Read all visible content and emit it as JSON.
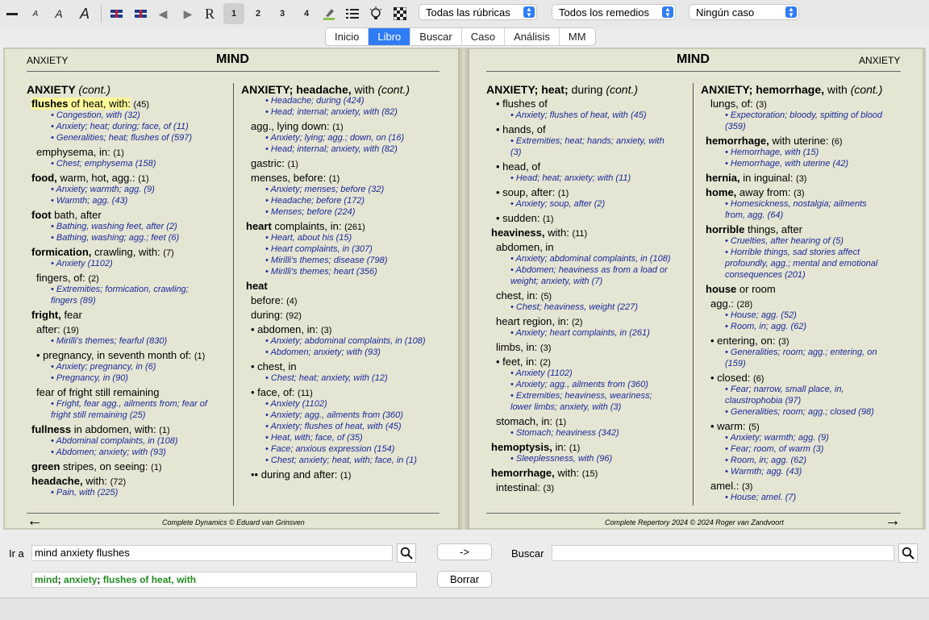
{
  "toolbar": {
    "font_small": "A",
    "font_med": "A",
    "font_large": "A",
    "restore": "R",
    "levels": [
      "1",
      "2",
      "3",
      "4"
    ],
    "select_rubrics": "Todas las rúbricas",
    "select_remedies": "Todos los remedios",
    "select_case": "Ningún caso"
  },
  "tabs": [
    "Inicio",
    "Libro",
    "Buscar",
    "Caso",
    "Análisis",
    "MM"
  ],
  "book": {
    "left": {
      "header_left": "ANXIETY",
      "title": "MIND",
      "footer": "Complete Dynamics © Eduard van Grinsven",
      "col1": [
        {
          "t": "h",
          "text": "ANXIETY",
          "it": "(cont.)"
        },
        {
          "t": "r",
          "b": "flushes",
          "text": " of heat, with:",
          "c": "(45)",
          "hl": true
        },
        {
          "t": "x",
          "text": "• Congestion, with (32)"
        },
        {
          "t": "x",
          "text": "• Anxiety; heat; during; face, of (11)"
        },
        {
          "t": "x",
          "text": "• Generalities; heat; flushes of (597)"
        },
        {
          "t": "r",
          "text": "emphysema, in:",
          "c": "(1)"
        },
        {
          "t": "x",
          "text": "• Chest; emphysema (158)"
        },
        {
          "t": "r",
          "b": "food,",
          "text": " warm, hot, agg.:",
          "c": "(1)"
        },
        {
          "t": "x",
          "text": "• Anxiety; warmth; agg. (9)"
        },
        {
          "t": "x",
          "text": "• Warmth; agg. (43)"
        },
        {
          "t": "r",
          "b": "foot",
          "text": " bath, after"
        },
        {
          "t": "x",
          "text": "• Bathing, washing feet, after (2)"
        },
        {
          "t": "x",
          "text": "• Bathing, washing; agg.; feet (6)"
        },
        {
          "t": "r",
          "b": "formication,",
          "text": " crawling, with:",
          "c": "(7)"
        },
        {
          "t": "x",
          "text": "• Anxiety (1102)"
        },
        {
          "t": "r",
          "text": "fingers, of:",
          "c": "(2)"
        },
        {
          "t": "x",
          "text": "• Extremities; formication, crawling;"
        },
        {
          "t": "x",
          "text": "fingers (89)"
        },
        {
          "t": "r",
          "b": "fright,",
          "text": " fear"
        },
        {
          "t": "r",
          "text": "after:",
          "c": "(19)"
        },
        {
          "t": "x",
          "text": "• Mirilli's themes; fearful (830)"
        },
        {
          "t": "r",
          "text": "• pregnancy, in seventh month of:",
          "c": "(1)"
        },
        {
          "t": "x",
          "text": "• Anxiety; pregnancy, in (6)"
        },
        {
          "t": "x",
          "text": "• Pregnancy, in (90)"
        },
        {
          "t": "r",
          "text": "fear of fright still remaining"
        },
        {
          "t": "x",
          "text": "• Fright, fear agg., ailments from; fear of"
        },
        {
          "t": "x",
          "text": "fright still remaining (25)"
        },
        {
          "t": "r",
          "b": "fullness",
          "text": " in abdomen, with:",
          "c": "(1)"
        },
        {
          "t": "x",
          "text": "• Abdominal complaints, in (108)"
        },
        {
          "t": "x",
          "text": "• Abdomen; anxiety; with (93)"
        },
        {
          "t": "r",
          "b": "green",
          "text": " stripes, on seeing:",
          "c": "(1)"
        },
        {
          "t": "r",
          "b": "headache,",
          "text": " with:",
          "c": "(72)"
        },
        {
          "t": "x",
          "text": "• Pain, with (225)"
        }
      ],
      "col2": [
        {
          "t": "h",
          "text": "ANXIETY; headache,",
          "plain": " with ",
          "it": "(cont.)"
        },
        {
          "t": "x",
          "text": "• Headache; during (424)"
        },
        {
          "t": "x",
          "text": "• Head; internal; anxiety, with (82)"
        },
        {
          "t": "r",
          "text": "agg., lying down:",
          "c": "(1)"
        },
        {
          "t": "x",
          "text": "• Anxiety; lying; agg.; down, on (16)"
        },
        {
          "t": "x",
          "text": "• Head; internal; anxiety, with (82)"
        },
        {
          "t": "r",
          "text": "gastric:",
          "c": "(1)"
        },
        {
          "t": "r",
          "text": "menses, before:",
          "c": "(1)"
        },
        {
          "t": "x",
          "text": "• Anxiety; menses; before (32)"
        },
        {
          "t": "x",
          "text": "• Headache; before (172)"
        },
        {
          "t": "x",
          "text": "• Menses; before (224)"
        },
        {
          "t": "r",
          "b": "heart",
          "text": " complaints, in:",
          "c": "(261)"
        },
        {
          "t": "x",
          "text": "• Heart, about his (15)"
        },
        {
          "t": "x",
          "text": "• Heart complaints, in (307)"
        },
        {
          "t": "x",
          "text": "• Mirilli's themes; disease (798)"
        },
        {
          "t": "x",
          "text": "• Mirilli's themes; heart (356)"
        },
        {
          "t": "r",
          "b": "heat"
        },
        {
          "t": "r",
          "text": "before:",
          "c": "(4)"
        },
        {
          "t": "r",
          "text": "during:",
          "c": "(92)"
        },
        {
          "t": "r",
          "text": "• abdomen, in:",
          "c": "(3)"
        },
        {
          "t": "x",
          "text": "• Anxiety; abdominal complaints, in (108)"
        },
        {
          "t": "x",
          "text": "• Abdomen; anxiety; with (93)"
        },
        {
          "t": "r",
          "text": "• chest, in"
        },
        {
          "t": "x",
          "text": "• Chest; heat; anxiety, with (12)"
        },
        {
          "t": "r",
          "text": "• face, of:",
          "c": "(11)"
        },
        {
          "t": "x",
          "text": "• Anxiety (1102)"
        },
        {
          "t": "x",
          "text": "• Anxiety; agg., ailments from (360)"
        },
        {
          "t": "x",
          "text": "• Anxiety; flushes of heat, with (45)"
        },
        {
          "t": "x",
          "text": "• Heat, with; face, of (35)"
        },
        {
          "t": "x",
          "text": "• Face; anxious expression (154)"
        },
        {
          "t": "x",
          "text": "• Chest; anxiety; heat, with; face, in (1)"
        },
        {
          "t": "r",
          "text": "•• during and after:",
          "c": "(1)"
        }
      ]
    },
    "right": {
      "title": "MIND",
      "header_right": "ANXIETY",
      "footer": "Complete Repertory 2024 © 2024 Roger van Zandvoort",
      "col1": [
        {
          "t": "h",
          "text": "ANXIETY; heat;",
          "plain": " during ",
          "it": "(cont.)"
        },
        {
          "t": "r",
          "text": "• flushes of"
        },
        {
          "t": "x",
          "text": "• Anxiety; flushes of heat, with (45)"
        },
        {
          "t": "r",
          "text": "• hands, of"
        },
        {
          "t": "x",
          "text": "• Extremities; heat; hands; anxiety, with"
        },
        {
          "t": "x",
          "text": "(3)"
        },
        {
          "t": "r",
          "text": "• head, of"
        },
        {
          "t": "x",
          "text": "• Head; heat; anxiety; with (11)"
        },
        {
          "t": "r",
          "text": "• soup, after:",
          "c": "(1)"
        },
        {
          "t": "x",
          "text": "• Anxiety; soup, after (2)"
        },
        {
          "t": "r",
          "text": "• sudden:",
          "c": "(1)"
        },
        {
          "t": "r",
          "b": "heaviness,",
          "text": " with:",
          "c": "(11)"
        },
        {
          "t": "r",
          "text": "abdomen, in"
        },
        {
          "t": "x",
          "text": "• Anxiety; abdominal complaints, in (108)"
        },
        {
          "t": "x",
          "text": "• Abdomen; heaviness as from a load or"
        },
        {
          "t": "x",
          "text": "weight; anxiety, with (7)"
        },
        {
          "t": "r",
          "text": "chest, in:",
          "c": "(5)"
        },
        {
          "t": "x",
          "text": "• Chest; heaviness, weight (227)"
        },
        {
          "t": "r",
          "text": "heart region, in:",
          "c": "(2)"
        },
        {
          "t": "x",
          "text": "• Anxiety; heart complaints, in (261)"
        },
        {
          "t": "r",
          "text": "limbs, in:",
          "c": "(3)"
        },
        {
          "t": "r",
          "text": "• feet, in:",
          "c": "(2)"
        },
        {
          "t": "x",
          "text": "• Anxiety (1102)"
        },
        {
          "t": "x",
          "text": "• Anxiety; agg., ailments from (360)"
        },
        {
          "t": "x",
          "text": "• Extremities; heaviness, weariness;"
        },
        {
          "t": "x",
          "text": "lower limbs; anxiety, with (3)"
        },
        {
          "t": "r",
          "text": "stomach, in:",
          "c": "(1)"
        },
        {
          "t": "x",
          "text": "• Stomach; heaviness (342)"
        },
        {
          "t": "r",
          "b": "hemoptysis,",
          "text": " in:",
          "c": "(1)"
        },
        {
          "t": "x",
          "text": "• Sleeplessness, with (96)"
        },
        {
          "t": "r",
          "b": "hemorrhage,",
          "text": " with:",
          "c": "(15)"
        },
        {
          "t": "r",
          "text": "intestinal:",
          "c": "(3)"
        }
      ],
      "col2": [
        {
          "t": "h",
          "text": "ANXIETY; hemorrhage,",
          "plain": " with ",
          "it": "(cont.)"
        },
        {
          "t": "r",
          "text": "lungs, of:",
          "c": "(3)"
        },
        {
          "t": "x",
          "text": "• Expectoration; bloody, spitting of blood"
        },
        {
          "t": "x",
          "text": "(359)"
        },
        {
          "t": "r",
          "b": "hemorrhage,",
          "text": " with uterine:",
          "c": "(6)"
        },
        {
          "t": "x",
          "text": "• Hemorrhage, with (15)"
        },
        {
          "t": "x",
          "text": "• Hemorrhage, with uterine (42)"
        },
        {
          "t": "r",
          "b": "hernia,",
          "text": " in inguinal:",
          "c": "(3)"
        },
        {
          "t": "r",
          "b": "home,",
          "text": " away from:",
          "c": "(3)"
        },
        {
          "t": "x",
          "text": "• Homesickness, nostalgia; ailments"
        },
        {
          "t": "x",
          "text": "from, agg. (64)"
        },
        {
          "t": "r",
          "b": "horrible",
          "text": " things, after"
        },
        {
          "t": "x",
          "text": "• Cruelties, after hearing of (5)"
        },
        {
          "t": "x",
          "text": "• Horrible things, sad stories affect"
        },
        {
          "t": "x",
          "text": "profoundly, agg.; mental and emotional"
        },
        {
          "t": "x",
          "text": "consequences (201)"
        },
        {
          "t": "r",
          "b": "house",
          "text": " or room"
        },
        {
          "t": "r",
          "text": "agg.:",
          "c": "(28)"
        },
        {
          "t": "x",
          "text": "• House; agg. (52)"
        },
        {
          "t": "x",
          "text": "• Room, in; agg. (62)"
        },
        {
          "t": "r",
          "text": "• entering, on:",
          "c": "(3)"
        },
        {
          "t": "x",
          "text": "• Generalities; room; agg.; entering, on"
        },
        {
          "t": "x",
          "text": "(159)"
        },
        {
          "t": "r",
          "text": "• closed:",
          "c": "(6)"
        },
        {
          "t": "x",
          "text": "• Fear; narrow, small place, in,"
        },
        {
          "t": "x",
          "text": "claustrophobia (97)"
        },
        {
          "t": "x",
          "text": "• Generalities; room; agg.; closed (98)"
        },
        {
          "t": "r",
          "text": "• warm:",
          "c": "(5)"
        },
        {
          "t": "x",
          "text": "• Anxiety; warmth; agg. (9)"
        },
        {
          "t": "x",
          "text": "• Fear; room, of warm (3)"
        },
        {
          "t": "x",
          "text": "• Room, in; agg. (62)"
        },
        {
          "t": "x",
          "text": "• Warmth; agg. (43)"
        },
        {
          "t": "r",
          "text": "amel.:",
          "c": "(3)"
        },
        {
          "t": "x",
          "text": "• House; amel. (7)"
        }
      ]
    }
  },
  "bottom": {
    "goto_label": "Ir a",
    "goto_value": "mind anxiety flushes",
    "goto_button": "->",
    "search_label": "Buscar",
    "search_value": "",
    "clear_button": "Borrar",
    "path": [
      {
        "text": "mind"
      },
      {
        "sep": "; "
      },
      {
        "text": "anxiety"
      },
      {
        "sep": "; "
      },
      {
        "text": "flushes of heat, with"
      }
    ]
  },
  "colors": {
    "accent": "#2f7cf6",
    "ref": "#1a2a9a",
    "path": "#228b22",
    "highlight": "#fcf99a"
  }
}
